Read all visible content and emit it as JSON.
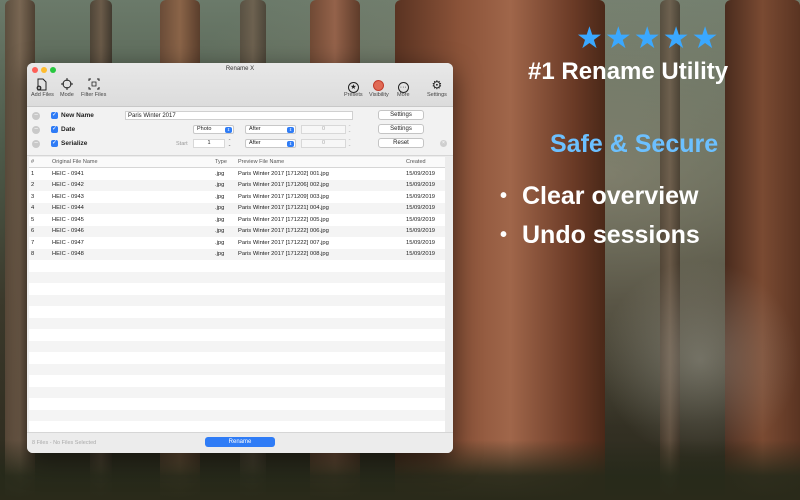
{
  "background": {
    "stars": "★★★★★",
    "headline": "#1 Rename Utility",
    "subheadline": "Safe & Secure",
    "bullets": [
      "Clear overview",
      "Undo sessions"
    ],
    "bullet_char": "•",
    "colors": {
      "stars": "#3aa8ff",
      "subheadline": "#6cc0ff"
    }
  },
  "window": {
    "title": "Rename X",
    "toolbar": {
      "add_files": "Add Files",
      "mode": "Mode",
      "filter_files": "Filter Files",
      "presets": "Presets",
      "visibility": "Visibility",
      "more": "More",
      "settings": "Settings"
    },
    "rules": [
      {
        "label": "New Name",
        "value": "Paris Winter 2017",
        "button": "Settings"
      },
      {
        "label": "Date",
        "source": "Photo",
        "position": "After",
        "number": "0",
        "button": "Settings"
      },
      {
        "label": "Serialize",
        "start_label": "Start",
        "start": "1",
        "position": "After",
        "number": "0",
        "button": "Reset"
      }
    ],
    "table": {
      "headers": {
        "num": "#",
        "original": "Original File Name",
        "type": "Type",
        "preview": "Preview File Name",
        "created": "Created"
      },
      "rows": [
        {
          "num": "1",
          "original": "HEIC - 0941",
          "type": ".jpg",
          "preview": "Paris Winter 2017 [171202] 001.jpg",
          "created": "15/09/2019"
        },
        {
          "num": "2",
          "original": "HEIC - 0942",
          "type": ".jpg",
          "preview": "Paris Winter 2017 [171206] 002.jpg",
          "created": "15/09/2019"
        },
        {
          "num": "3",
          "original": "HEIC - 0943",
          "type": ".jpg",
          "preview": "Paris Winter 2017 [171209] 003.jpg",
          "created": "15/09/2019"
        },
        {
          "num": "4",
          "original": "HEIC - 0944",
          "type": ".jpg",
          "preview": "Paris Winter 2017 [171221] 004.jpg",
          "created": "15/09/2019"
        },
        {
          "num": "5",
          "original": "HEIC - 0945",
          "type": ".jpg",
          "preview": "Paris Winter 2017 [171222] 005.jpg",
          "created": "15/09/2019"
        },
        {
          "num": "6",
          "original": "HEIC - 0946",
          "type": ".jpg",
          "preview": "Paris Winter 2017 [171222] 006.jpg",
          "created": "15/09/2019"
        },
        {
          "num": "7",
          "original": "HEIC - 0947",
          "type": ".jpg",
          "preview": "Paris Winter 2017 [171222] 007.jpg",
          "created": "15/09/2019"
        },
        {
          "num": "8",
          "original": "HEIC - 0948",
          "type": ".jpg",
          "preview": "Paris Winter 2017 [171222] 008.jpg",
          "created": "15/09/2019"
        }
      ]
    },
    "footer": {
      "status": "8 Files - No Files Selected",
      "rename_button": "Rename"
    },
    "accent_color": "#2f7cf6"
  }
}
